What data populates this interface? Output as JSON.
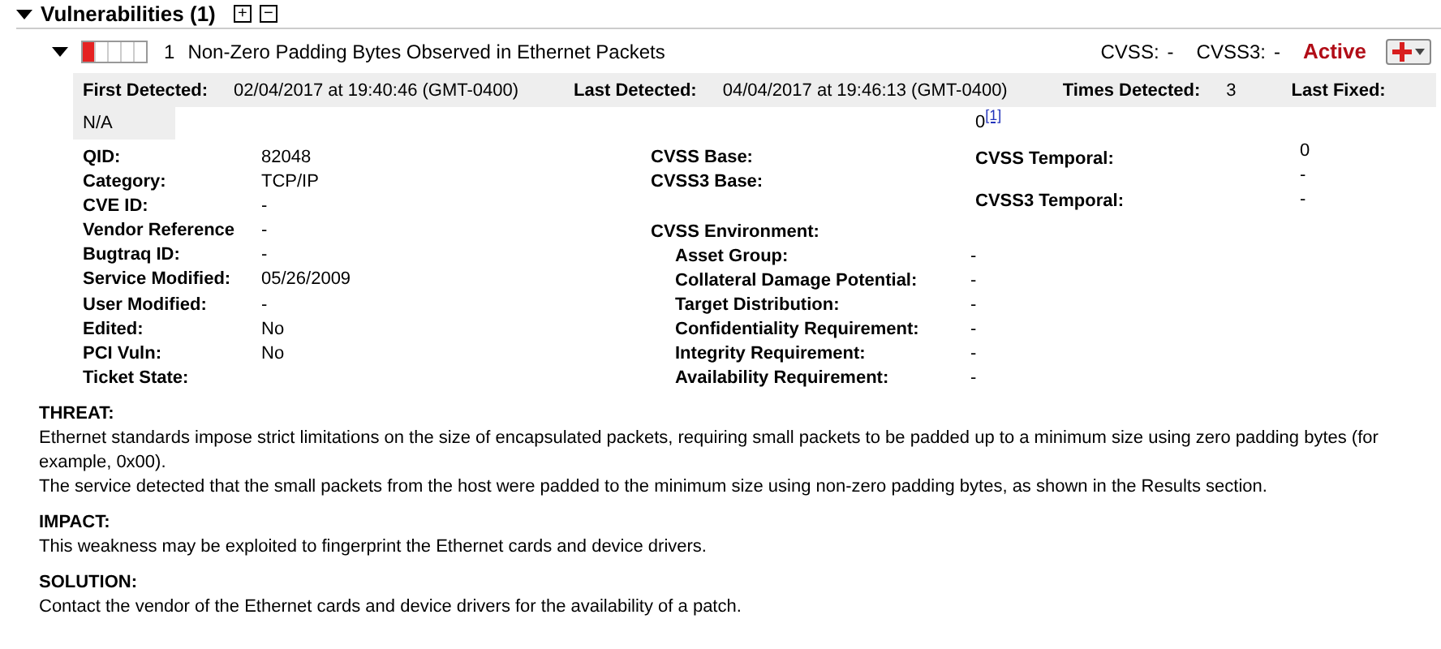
{
  "section": {
    "title": "Vulnerabilities (1)",
    "expanded": true,
    "expand_all": "+",
    "collapse_all": "−"
  },
  "vulnerability": {
    "expanded": true,
    "severity": {
      "level": 0.2
    },
    "number": "1",
    "title": "Non-Zero Padding Bytes Observed in Ethernet Packets",
    "cvss": [
      {
        "label": "CVSS:",
        "value": "-"
      },
      {
        "label": "CVSS3:",
        "value": "-"
      }
    ],
    "status": "Active"
  },
  "detection": [
    {
      "label": "First Detected:",
      "value": "02/04/2017 at 19:40:46 (GMT-0400)"
    },
    {
      "label": "Last Detected:",
      "value": "04/04/2017 at 19:46:13 (GMT-0400)"
    },
    {
      "label": "Times Detected:",
      "value": "3"
    },
    {
      "label": "Last Fixed:"
    }
  ],
  "last_fixed_value": "N/A",
  "cvss_score": {
    "value": "0",
    "footnote": "[1]"
  },
  "details": [
    {
      "label": "QID:",
      "value": "82048"
    },
    {
      "label": "Category:",
      "value": "TCP/IP"
    },
    {
      "label": "CVE ID:",
      "value": "-"
    },
    {
      "label": "Vendor Reference",
      "value": "-"
    },
    {
      "label": "Bugtraq ID:",
      "value": "-"
    },
    {
      "label": "Service Modified:",
      "value": "05/26/2009"
    },
    {
      "label": "User Modified:",
      "value": "-"
    },
    {
      "label": "Edited:",
      "value": "No"
    },
    {
      "label": "PCI Vuln:",
      "value": "No"
    },
    {
      "label": "Ticket State:"
    }
  ],
  "cvss_base": [
    "CVSS Base:",
    "CVSS3 Base:"
  ],
  "temporal": {
    "labels": [
      "CVSS Temporal:",
      "CVSS3 Temporal:"
    ],
    "values": [
      "0",
      "-",
      "-"
    ]
  },
  "environment": {
    "title": "CVSS Environment:",
    "items": [
      {
        "label": "Asset Group:",
        "value": "-"
      },
      {
        "label": "Collateral Damage Potential:",
        "value": "-"
      },
      {
        "label": "Target Distribution:",
        "value": "-"
      },
      {
        "label": "Confidentiality Requirement:",
        "value": "-"
      },
      {
        "label": "Integrity Requirement:",
        "value": "-"
      },
      {
        "label": "Availability Requirement:",
        "value": "-"
      }
    ]
  },
  "texts": [
    {
      "heading": "THREAT:",
      "paragraphs": [
        "Ethernet standards impose strict limitations on the size of encapsulated packets, requiring small packets to be padded up to a minimum size using zero padding bytes (for example, 0x00).",
        "The service detected that the small packets from the host were padded to the minimum size using non-zero padding bytes, as shown in the Results section."
      ]
    },
    {
      "heading": "IMPACT:",
      "paragraphs": [
        "This weakness may be exploited to fingerprint the Ethernet cards and device drivers."
      ]
    },
    {
      "heading": "SOLUTION:",
      "paragraphs": [
        "Contact the vendor of the Ethernet cards and device drivers for the availability of a patch."
      ]
    }
  ]
}
